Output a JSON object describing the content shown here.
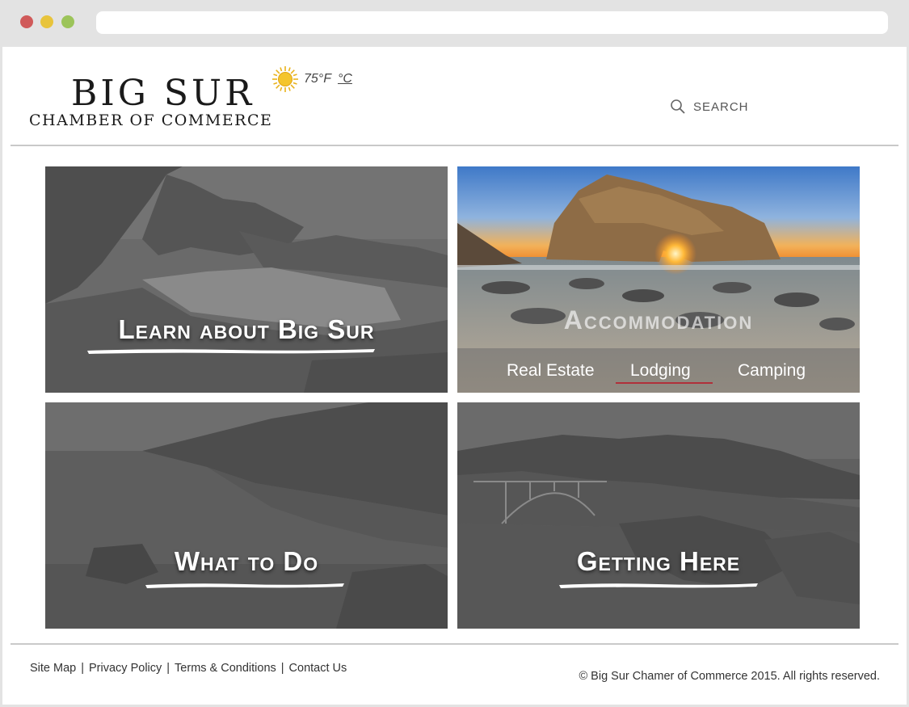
{
  "header": {
    "logo_title": "BIG SUR",
    "logo_subtitle": "CHAMBER OF COMMERCE",
    "weather": {
      "temp_f": "75°F",
      "temp_c": "°C",
      "icon": "sun-icon"
    },
    "search_label": "SEARCH"
  },
  "tiles": {
    "learn": {
      "title": "Learn about Big Sur"
    },
    "accommodation": {
      "title": "Accommodation",
      "subnav": [
        "Real Estate",
        "Lodging",
        "Camping"
      ],
      "active": "Lodging"
    },
    "todo": {
      "title": "What to Do"
    },
    "getting": {
      "title": "Getting Here"
    }
  },
  "footer": {
    "links": [
      "Site Map",
      "Privacy Policy",
      "Terms & Conditions",
      "Contact Us"
    ],
    "copyright": "© Big Sur Chamer of Commerce 2015. All rights reserved."
  },
  "colors": {
    "accent_underline": "#b0303a",
    "tile_overlay": "#5f5f5f"
  }
}
